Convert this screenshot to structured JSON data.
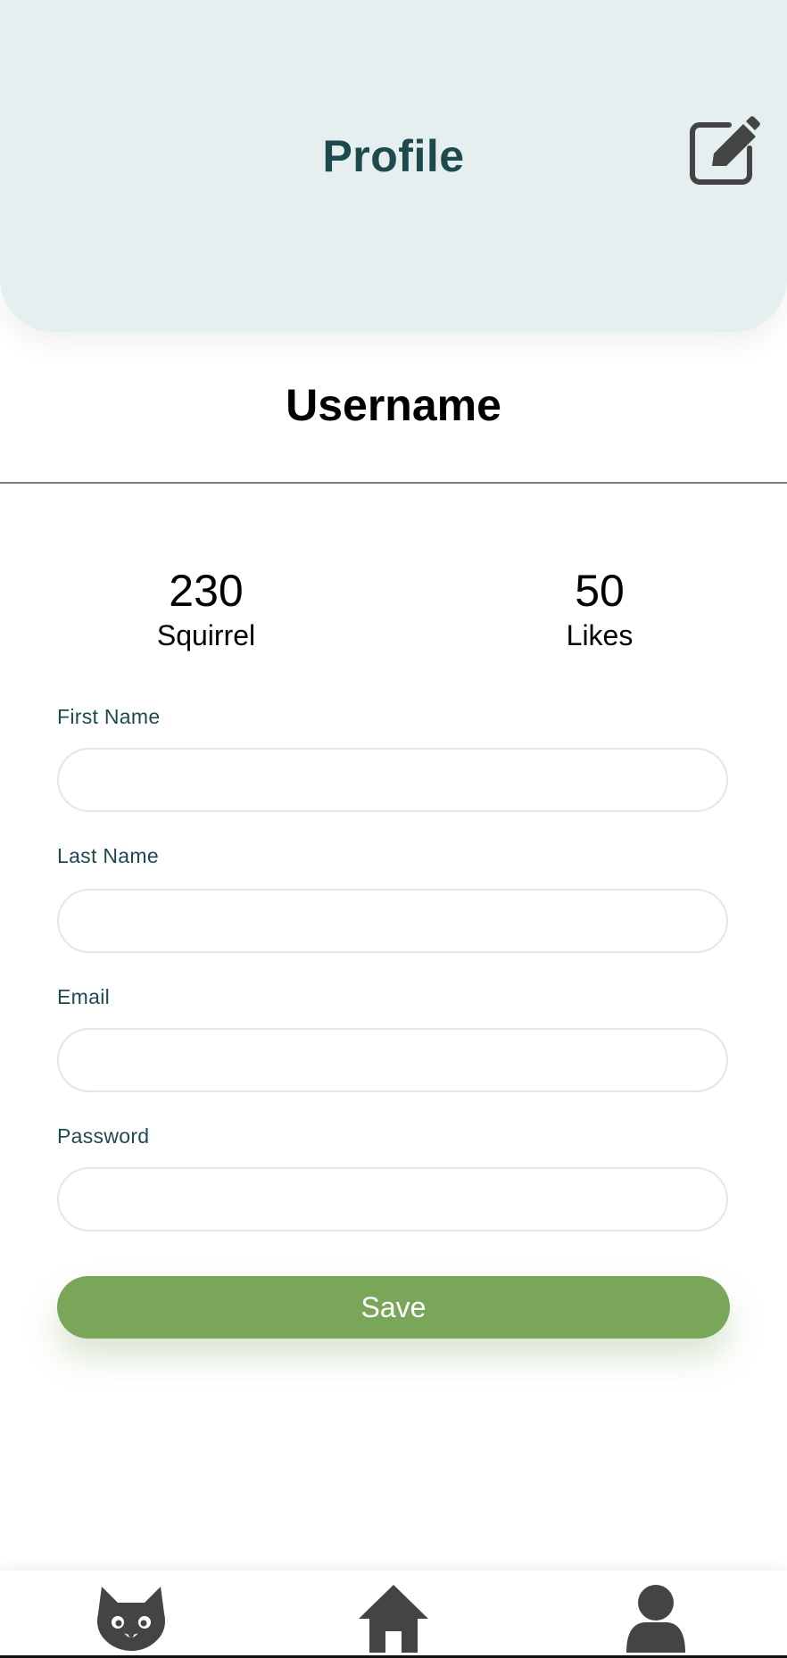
{
  "header": {
    "title": "Profile",
    "edit_icon": "edit-square-icon"
  },
  "profile": {
    "username": "Username"
  },
  "stats": [
    {
      "value": "230",
      "label": "Squirrel"
    },
    {
      "value": "50",
      "label": "Likes"
    }
  ],
  "form": {
    "first_name": {
      "label": "First Name",
      "value": "",
      "placeholder": ""
    },
    "last_name": {
      "label": "Last Name",
      "value": "",
      "placeholder": ""
    },
    "email": {
      "label": "Email",
      "value": "",
      "placeholder": ""
    },
    "password": {
      "label": "Password",
      "value": "",
      "placeholder": ""
    },
    "save_label": "Save"
  },
  "bottom_nav": {
    "items": [
      {
        "icon": "squirrel-icon"
      },
      {
        "icon": "home-icon"
      },
      {
        "icon": "user-icon"
      }
    ]
  },
  "colors": {
    "header_bg": "#e5efef",
    "title": "#1e4a4e",
    "accent": "#7aa65a",
    "icon": "#444444"
  }
}
